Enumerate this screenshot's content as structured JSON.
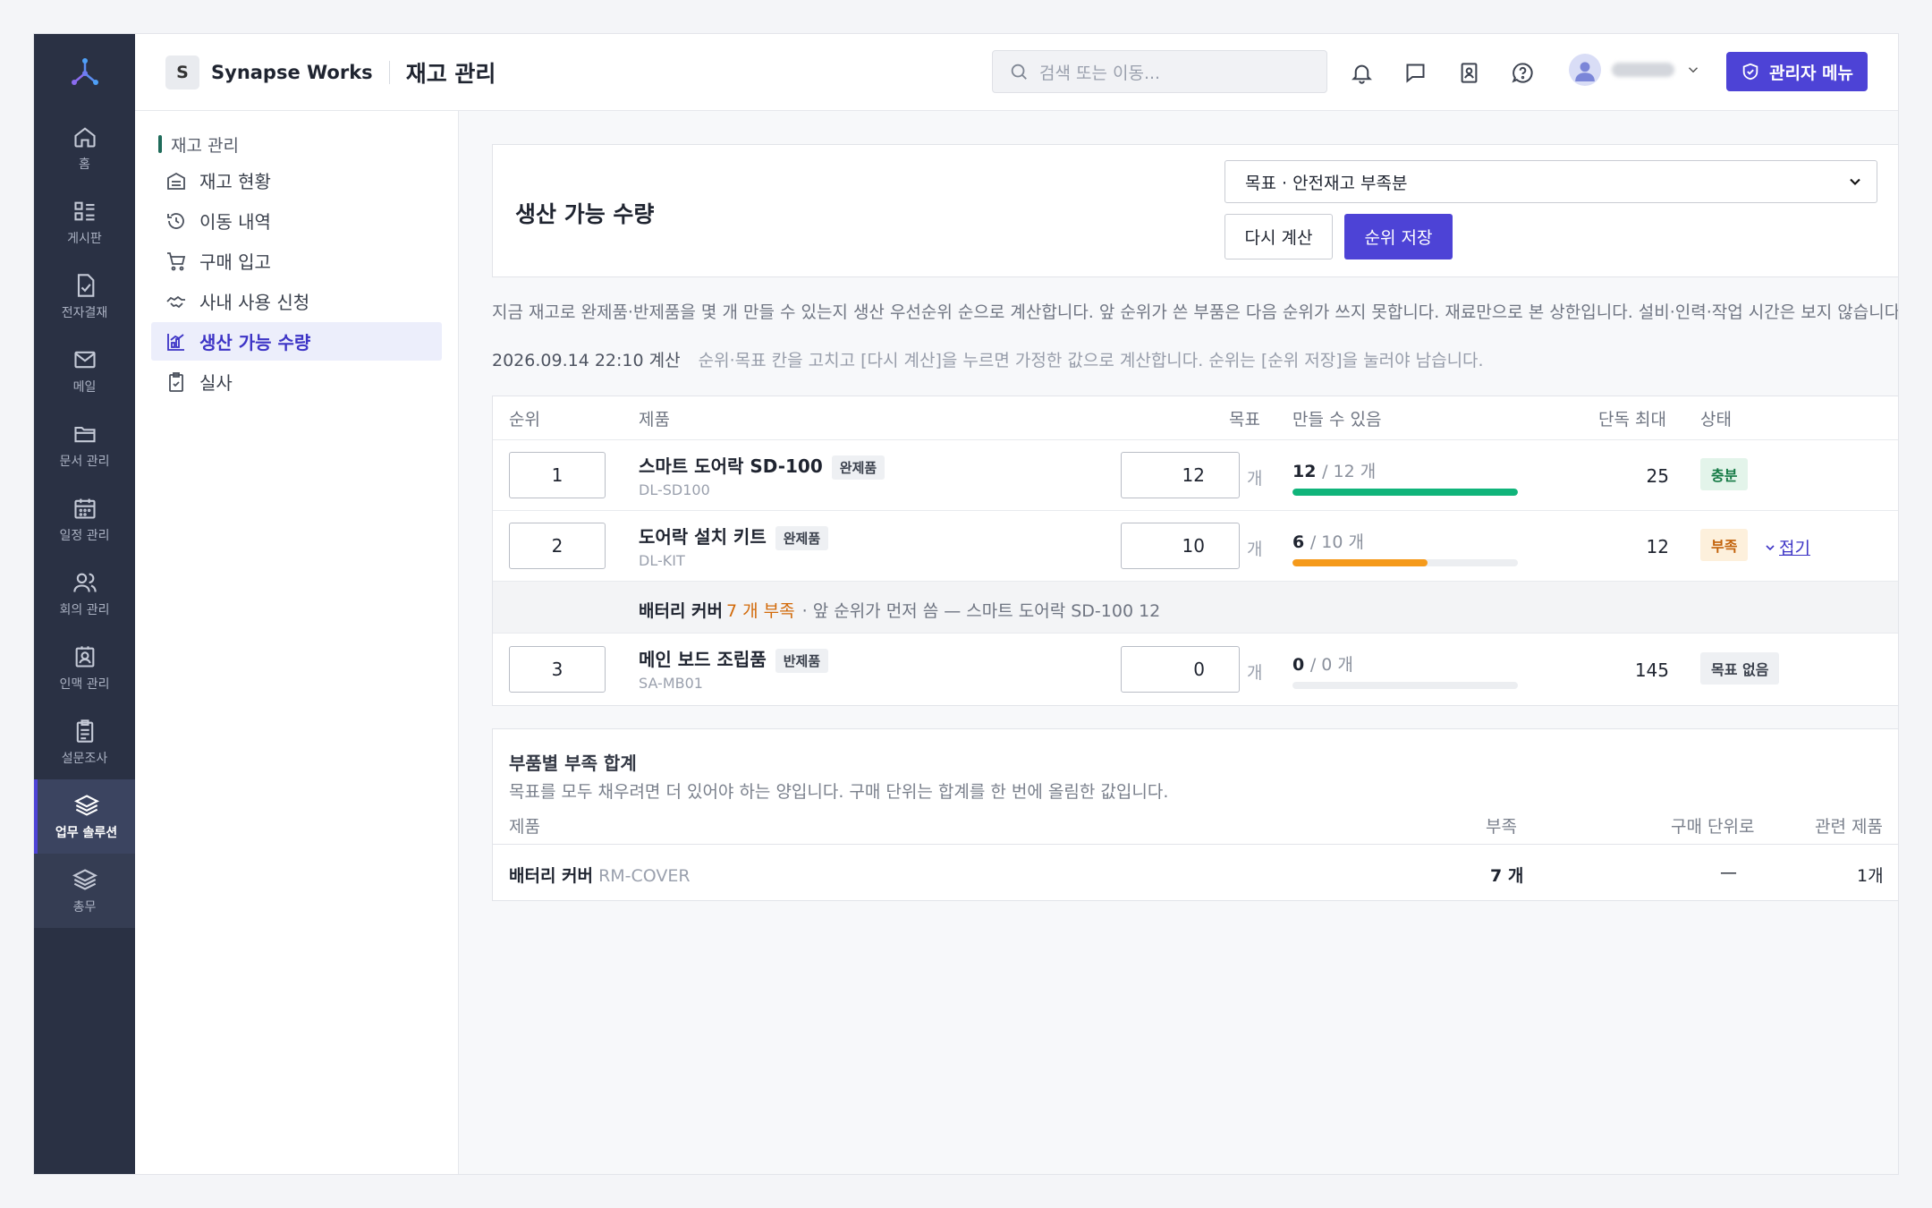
{
  "nav": {
    "items": [
      {
        "label": "홈",
        "icon": "home-icon"
      },
      {
        "label": "게시판",
        "icon": "board-icon"
      },
      {
        "label": "전자결재",
        "icon": "approval-icon"
      },
      {
        "label": "메일",
        "icon": "mail-icon"
      },
      {
        "label": "문서 관리",
        "icon": "folder-icon"
      },
      {
        "label": "일정 관리",
        "icon": "calendar-icon"
      },
      {
        "label": "회의 관리",
        "icon": "users-icon"
      },
      {
        "label": "인맥 관리",
        "icon": "contact-icon"
      },
      {
        "label": "설문조사",
        "icon": "survey-icon"
      },
      {
        "label": "업무 솔루션",
        "icon": "layers-icon"
      },
      {
        "label": "총무",
        "icon": "layers-icon"
      }
    ]
  },
  "header": {
    "org_initial": "S",
    "org_name": "Synapse Works",
    "page_title": "재고 관리",
    "search_placeholder": "검색 또는 이동...",
    "admin_label": "관리자 메뉴"
  },
  "subnav": {
    "title": "재고 관리",
    "items": [
      {
        "label": "재고 현황"
      },
      {
        "label": "이동 내역"
      },
      {
        "label": "구매 입고"
      },
      {
        "label": "사내 사용 신청"
      },
      {
        "label": "생산 가능 수량"
      },
      {
        "label": "실사"
      }
    ]
  },
  "main": {
    "title": "생산 가능 수량",
    "select_value": "목표 · 안전재고 부족분",
    "recalc_label": "다시 계산",
    "save_label": "순위 저장",
    "description": "지금 재고로 완제품·반제품을 몇 개 만들 수 있는지 생산 우선순위 순으로 계산합니다. 앞 순위가 쓴 부품은 다음 순위가 쓰지 못합니다. 재료만으로 본 상한입니다. 설비·인력·작업 시간은 보지 않습니다.",
    "calc_time": "2026.09.14 22:10 계산",
    "calc_hint": "순위·목표 칸을 고치고 [다시 계산]을 누르면 가정한 값으로 계산합니다. 순위는 [순위 저장]을 눌러야 남습니다."
  },
  "table": {
    "headers": {
      "rank": "순위",
      "product": "제품",
      "target": "목표",
      "can_make": "만들 수 있음",
      "max": "단독 최대",
      "status": "상태"
    },
    "unit": "개",
    "rows": [
      {
        "rank": "1",
        "name": "스마트 도어락 SD-100",
        "tag": "완제품",
        "code": "DL-SD100",
        "target": "12",
        "can": "12",
        "of": "/ 12 개",
        "progress": 1.0,
        "bar_color": "#10b47a",
        "max": "25",
        "status": "충분",
        "status_bg": "#e3f4ea",
        "status_fg": "#157a45"
      },
      {
        "rank": "2",
        "name": "도어락 설치 키트",
        "tag": "완제품",
        "code": "DL-KIT",
        "target": "10",
        "can": "6",
        "of": "/ 10 개",
        "progress": 0.6,
        "bar_color": "#f59a1b",
        "max": "12",
        "status": "부족",
        "status_bg": "#fdf0dc",
        "status_fg": "#c2610a"
      },
      {
        "rank": "3",
        "name": "메인 보드 조립품",
        "tag": "반제품",
        "code": "SA-MB01",
        "target": "0",
        "can": "0",
        "of": "/ 0 개",
        "progress": 0,
        "bar_color": "#cfd3da",
        "max": "145",
        "status": "목표 없음",
        "status_bg": "#eef0f3",
        "status_fg": "#3a404c"
      }
    ],
    "fold_label": "접기",
    "shortage": {
      "part": "배터리 커버",
      "amount": "7 개 부족",
      "note": "· 앞 순위가 먼저 씀 — 스마트 도어락 SD-100 12"
    }
  },
  "summary": {
    "title": "부품별 부족 합계",
    "description": "목표를 모두 채우려면 더 있어야 하는 양입니다. 구매 단위는 합계를 한 번에 올림한 값입니다.",
    "headers": {
      "part": "제품",
      "short": "부족",
      "purchase": "구매 단위로",
      "related": "관련 제품"
    },
    "rows": [
      {
        "name": "배터리 커버",
        "code": "RM-COVER",
        "short": "7 개",
        "purchase": "—",
        "related": "1개"
      }
    ]
  }
}
